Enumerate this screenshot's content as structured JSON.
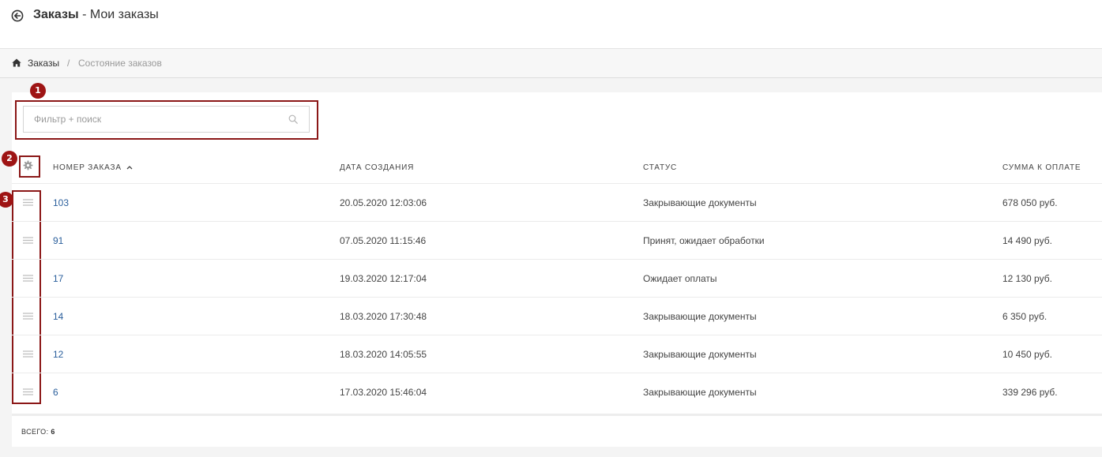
{
  "header": {
    "title_bold": "Заказы",
    "title_rest": " - Мои заказы"
  },
  "breadcrumb": {
    "home_label": "Заказы",
    "separator": "/",
    "current": "Состояние заказов"
  },
  "search": {
    "placeholder": "Фильтр + поиск"
  },
  "annotations": [
    "1",
    "2",
    "3"
  ],
  "table": {
    "columns": [
      "Номер заказа",
      "Дата создания",
      "Статус",
      "Сумма к оплате"
    ],
    "rows": [
      {
        "number": "103",
        "date": "20.05.2020 12:03:06",
        "status": "Закрывающие документы",
        "amount": "678 050 руб."
      },
      {
        "number": "91",
        "date": "07.05.2020 11:15:46",
        "status": "Принят, ожидает обработки",
        "amount": "14 490 руб."
      },
      {
        "number": "17",
        "date": "19.03.2020 12:17:04",
        "status": "Ожидает оплаты",
        "amount": "12 130 руб."
      },
      {
        "number": "14",
        "date": "18.03.2020 17:30:48",
        "status": "Закрывающие документы",
        "amount": "6 350 руб."
      },
      {
        "number": "12",
        "date": "18.03.2020 14:05:55",
        "status": "Закрывающие документы",
        "amount": "10 450 руб."
      },
      {
        "number": "6",
        "date": "17.03.2020 15:46:04",
        "status": "Закрывающие документы",
        "amount": "339 296 руб."
      }
    ]
  },
  "footer": {
    "total_label": "Всего:",
    "total_value": "6"
  },
  "colors": {
    "accent_annotation": "#9e1414",
    "link": "#2b5f9c"
  },
  "icons": [
    "back-arrow-icon",
    "home-icon",
    "search-icon",
    "gear-icon",
    "sort-up-icon",
    "drag-handle-icon"
  ]
}
